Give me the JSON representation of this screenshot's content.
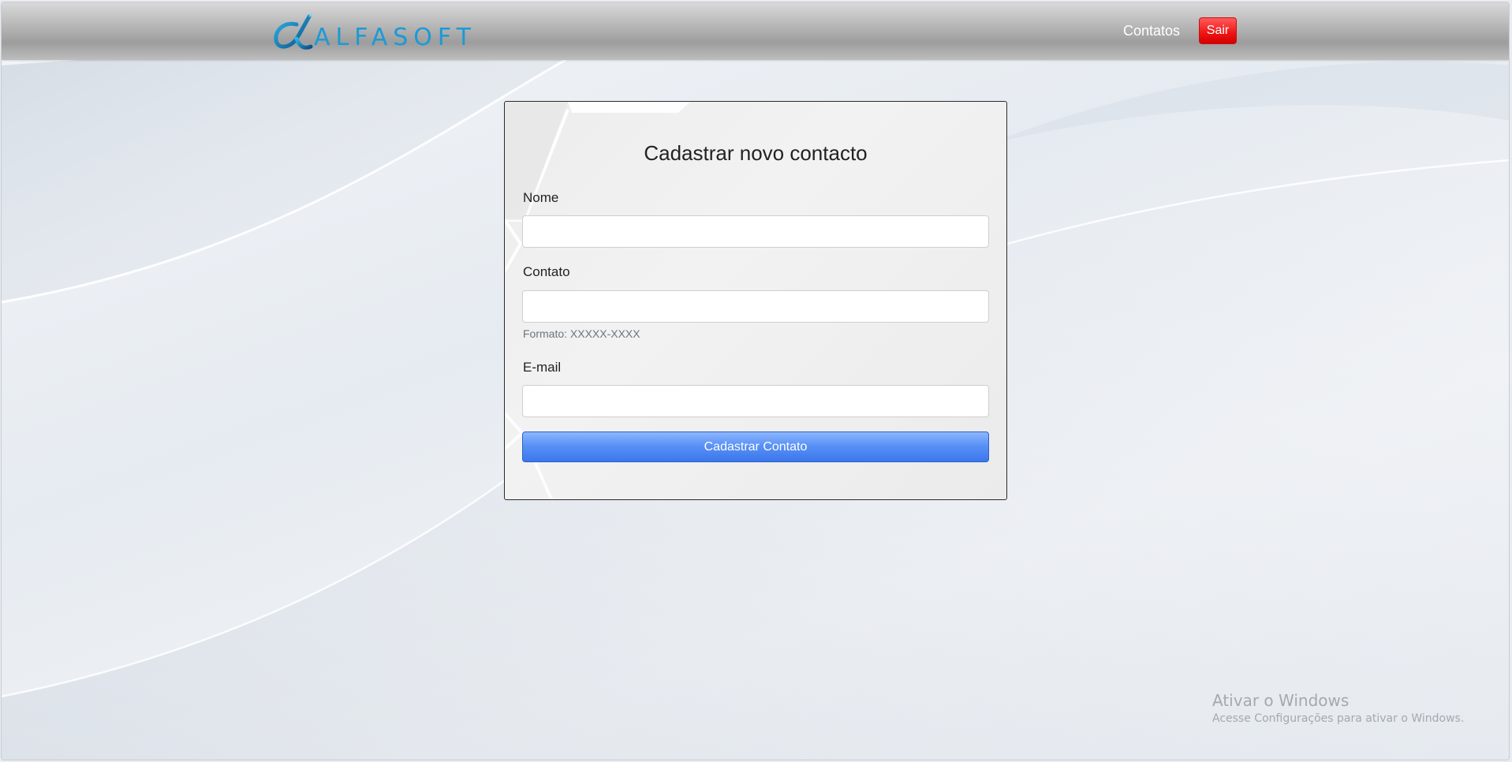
{
  "header": {
    "logo_text": "ALFASOFT",
    "nav_contatos": "Contatos",
    "logout_label": "Sair",
    "colors": {
      "logout_bg": "#ee1414",
      "logo_blue": "#1b9ad6"
    }
  },
  "form": {
    "title": "Cadastrar novo contacto",
    "fields": {
      "nome": {
        "label": "Nome",
        "value": ""
      },
      "contato": {
        "label": "Contato",
        "value": "",
        "help": "Formato: XXXXX-XXXX"
      },
      "email": {
        "label": "E-mail",
        "value": ""
      }
    },
    "submit_label": "Cadastrar Contato",
    "colors": {
      "submit_bg": "#3b77ec"
    }
  },
  "watermark": {
    "title": "Ativar o Windows",
    "subtitle": "Acesse Configurações para ativar o Windows."
  }
}
